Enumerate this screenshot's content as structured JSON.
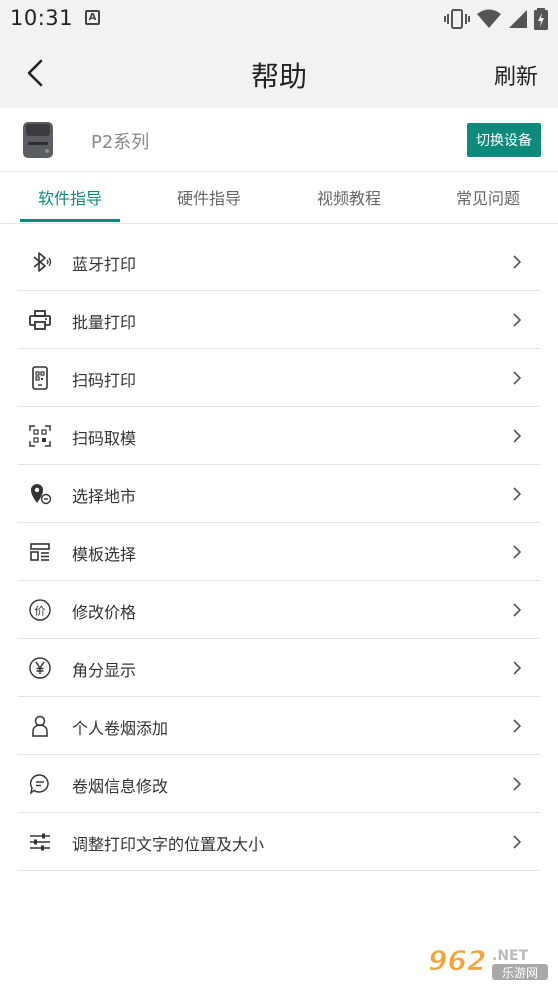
{
  "status_bar": {
    "time": "10:31",
    "keyboard_badge": "A"
  },
  "nav": {
    "title": "帮助",
    "refresh_label": "刷新"
  },
  "device": {
    "name": "P2系列",
    "switch_label": "切换设备"
  },
  "tabs": [
    {
      "label": "软件指导",
      "active": true
    },
    {
      "label": "硬件指导",
      "active": false
    },
    {
      "label": "视频教程",
      "active": false
    },
    {
      "label": "常见问题",
      "active": false
    }
  ],
  "items": [
    {
      "label": "蓝牙打印",
      "icon": "bluetooth-icon"
    },
    {
      "label": "批量打印",
      "icon": "printer-icon"
    },
    {
      "label": "扫码打印",
      "icon": "phone-qr-icon"
    },
    {
      "label": "扫码取模",
      "icon": "qr-scan-icon"
    },
    {
      "label": "选择地市",
      "icon": "location-icon"
    },
    {
      "label": "模板选择",
      "icon": "template-icon"
    },
    {
      "label": "修改价格",
      "icon": "price-icon"
    },
    {
      "label": "角分显示",
      "icon": "yen-icon"
    },
    {
      "label": "个人卷烟添加",
      "icon": "person-icon"
    },
    {
      "label": "卷烟信息修改",
      "icon": "message-icon"
    },
    {
      "label": "调整打印文字的位置及大小",
      "icon": "sliders-icon"
    }
  ],
  "watermark": {
    "brand": "962.NET",
    "site": "乐游网"
  },
  "colors": {
    "accent": "#0e8a7d",
    "header_bg": "#f2f2f2"
  }
}
